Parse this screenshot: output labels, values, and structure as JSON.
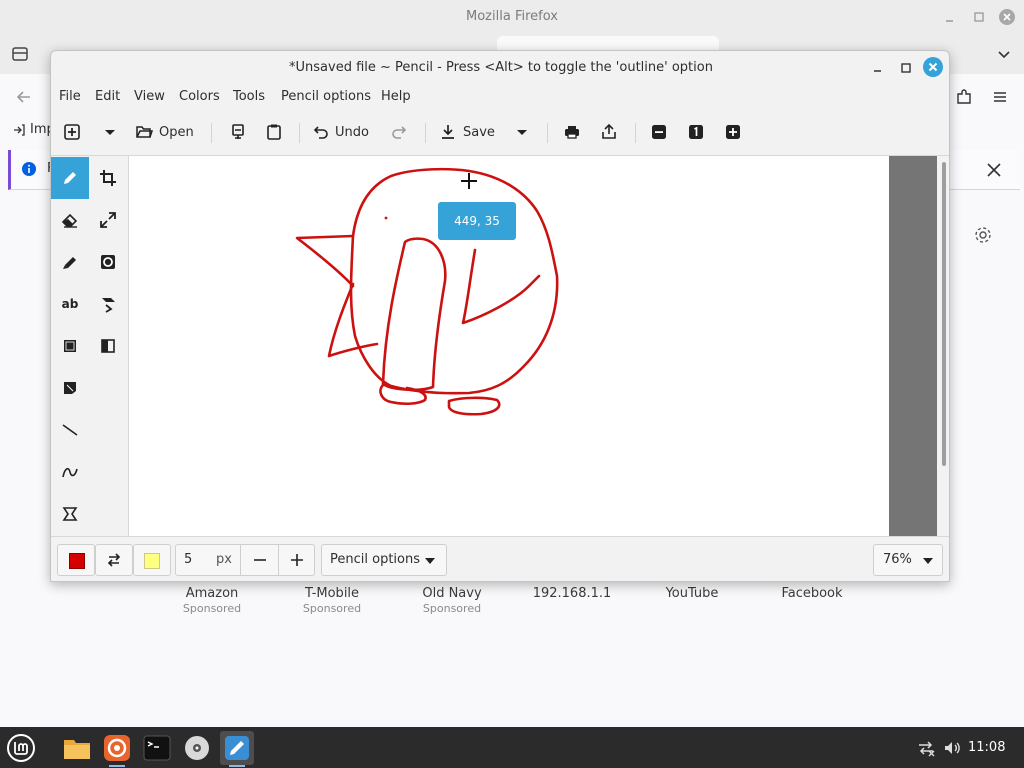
{
  "firefox": {
    "title": "Mozilla Firefox",
    "import_label": "Imp",
    "notice_text": "F",
    "shortcuts": [
      {
        "name": "Amazon",
        "sponsored": "Sponsored"
      },
      {
        "name": "T-Mobile",
        "sponsored": "Sponsored"
      },
      {
        "name": "Old Navy",
        "sponsored": "Sponsored"
      },
      {
        "name": "192.168.1.1",
        "sponsored": ""
      },
      {
        "name": "YouTube",
        "sponsored": ""
      },
      {
        "name": "Facebook",
        "sponsored": ""
      }
    ]
  },
  "pencil": {
    "title": "*Unsaved file ~ Pencil - Press <Alt> to toggle the 'outline' option",
    "menu": [
      "File",
      "Edit",
      "View",
      "Colors",
      "Tools",
      "Pencil options",
      "Help"
    ],
    "toolbar": {
      "open": "Open",
      "undo": "Undo",
      "save": "Save"
    },
    "tools": [
      "pencil",
      "crop",
      "eraser",
      "scale",
      "highlighter",
      "filters",
      "text",
      "skew",
      "rectangle",
      "color-picker",
      "free-shape",
      "line",
      "curve",
      "polygon"
    ],
    "coord_tooltip": "449, 35",
    "bottombar": {
      "main_color": "#d40000",
      "secondary_color": "#ffff80",
      "size_value": "5",
      "size_unit": "px",
      "options_label": "Pencil options",
      "zoom": "76%"
    },
    "drawing_color": "#cc1111"
  },
  "taskbar": {
    "clock": "11:08",
    "apps": [
      "files",
      "firefox",
      "terminal",
      "disks",
      "drawing"
    ]
  }
}
